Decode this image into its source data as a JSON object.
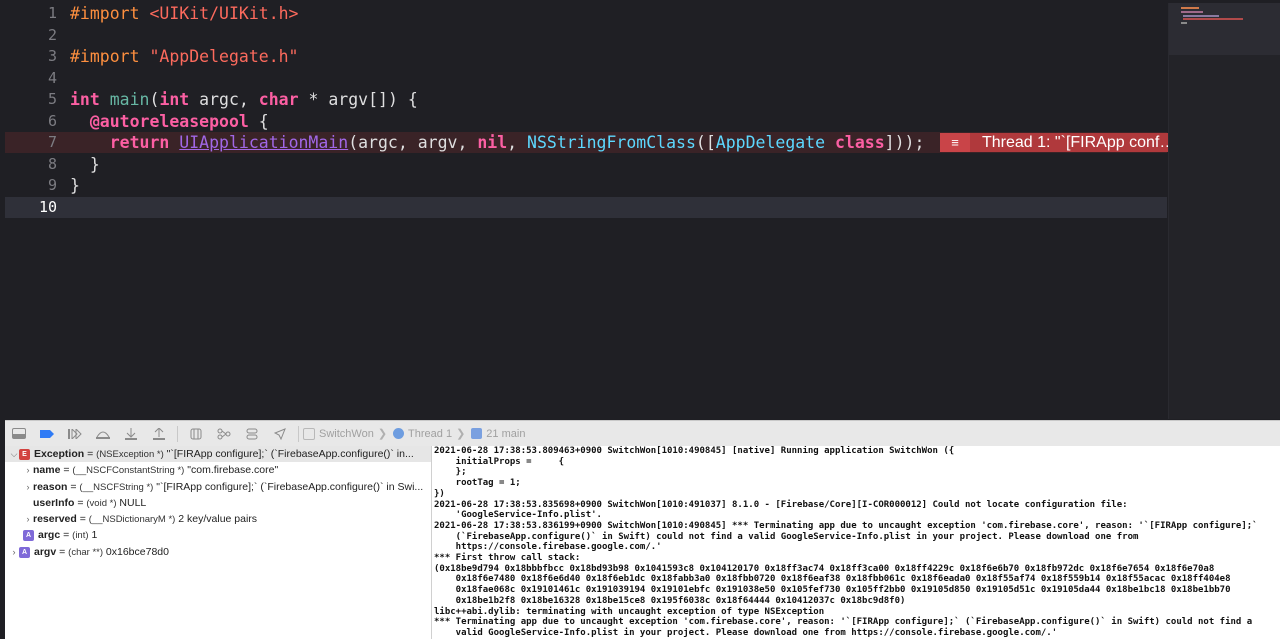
{
  "editor": {
    "line_numbers": [
      "1",
      "2",
      "3",
      "4",
      "5",
      "6",
      "7",
      "8",
      "9",
      "10"
    ],
    "code": {
      "l1_import": "#import",
      "l1_path": "<UIKit/UIKit.h>",
      "l3_import": "#import",
      "l3_path": "\"AppDelegate.h\"",
      "l5_int1": "int",
      "l5_main": "main",
      "l5_open": "(",
      "l5_int2": "int",
      "l5_argc": " argc, ",
      "l5_char": "char",
      "l5_rest": " * argv[]) {",
      "l6_pool": "@autoreleasepool",
      "l6_brace": " {",
      "l7_return": "return",
      "l7_uiapp": "UIApplicationMain",
      "l7_args": "(argc, argv, ",
      "l7_nil": "nil",
      "l7_comma": ", ",
      "l7_nsstr": "NSStringFromClass",
      "l7_open": "([",
      "l7_appdel": "AppDelegate",
      "l7_space": " ",
      "l7_class": "class",
      "l7_close": "]));",
      "l8": "}",
      "l9": "}"
    },
    "error_banner": "Thread 1: \"`[FIRApp conf…"
  },
  "debug_bar": {
    "crumbs": [
      "SwitchWon",
      "Thread 1",
      "21 main"
    ]
  },
  "variables": [
    {
      "name": "Exception",
      "eq": " = ",
      "type": "(NSException *)",
      "value": " \"`[FIRApp configure];` (`FirebaseApp.configure()` in...",
      "badge": "E"
    },
    {
      "name": "name",
      "eq": " = ",
      "type": "(__NSCFConstantString *)",
      "value": " \"com.firebase.core\""
    },
    {
      "name": "reason",
      "eq": " = ",
      "type": "(__NSCFString *)",
      "value": " \"`[FIRApp configure];` (`FirebaseApp.configure()` in Swi..."
    },
    {
      "name": "userInfo",
      "eq": " = ",
      "type": "(void *)",
      "value": " NULL"
    },
    {
      "name": "reserved",
      "eq": " = ",
      "type": "(__NSDictionaryM *)",
      "value": " 2 key/value pairs"
    },
    {
      "name": "argc",
      "eq": " = ",
      "type": "(int)",
      "value": " 1",
      "badge": "A"
    },
    {
      "name": "argv",
      "eq": " = ",
      "type": "(char **)",
      "value": " 0x16bce78d0",
      "badge": "A"
    }
  ],
  "console_lines": [
    "2021-06-28 17:38:53.809463+0900 SwitchWon[1010:490845] [native] Running application SwitchWon ({",
    "    initialProps =     {",
    "    };",
    "    rootTag = 1;",
    "})",
    "2021-06-28 17:38:53.835698+0900 SwitchWon[1010:491037] 8.1.0 - [Firebase/Core][I-COR000012] Could not locate configuration file:",
    "    'GoogleService-Info.plist'.",
    "2021-06-28 17:38:53.836199+0900 SwitchWon[1010:490845] *** Terminating app due to uncaught exception 'com.firebase.core', reason: '`[FIRApp configure];`",
    "    (`FirebaseApp.configure()` in Swift) could not find a valid GoogleService-Info.plist in your project. Please download one from",
    "    https://console.firebase.google.com/.'",
    "*** First throw call stack:",
    "(0x18be9d794 0x18bbbfbcc 0x18bd93b98 0x1041593c8 0x104120170 0x18ff3ac74 0x18ff3ca00 0x18ff4229c 0x18f6e6b70 0x18fb972dc 0x18f6e7654 0x18f6e70a8",
    "    0x18f6e7480 0x18f6e6d40 0x18f6eb1dc 0x18fabb3a0 0x18fbb0720 0x18f6eaf38 0x18fbb061c 0x18f6eada0 0x18f55af74 0x18f559b14 0x18f55acac 0x18ff404e8",
    "    0x18fae068c 0x19101461c 0x191039194 0x19101ebfc 0x191038e50 0x105fef730 0x105ff2bb0 0x19105d850 0x19105d51c 0x19105da44 0x18be1bc18 0x18be1bb70",
    "    0x18be1b2f8 0x18be16328 0x18be15ce8 0x195f6038c 0x18f64444 0x10412037c 0x18bc9d8f0)",
    "libc++abi.dylib: terminating with uncaught exception of type NSException",
    "*** Terminating app due to uncaught exception 'com.firebase.core', reason: '`[FIRApp configure];` (`FirebaseApp.configure()` in Swift) could not find a",
    "    valid GoogleService-Info.plist in your project. Please download one from https://console.firebase.google.com/.'"
  ]
}
